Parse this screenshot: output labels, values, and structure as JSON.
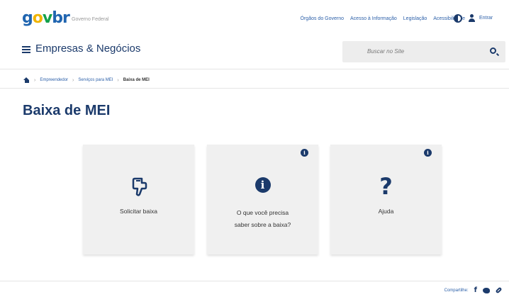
{
  "govbar": {
    "logo": {
      "g": "g",
      "o": "o",
      "v": "v",
      "br": "br"
    },
    "subtitle": "Governo Federal",
    "links": [
      "Órgãos do Governo",
      "Acesso à Informação",
      "Legislação",
      "Acessibilidade"
    ],
    "login_label": "Entrar"
  },
  "header": {
    "site_title": "Empresas & Negócios",
    "search_placeholder": "Buscar no Site"
  },
  "breadcrumb": {
    "items": [
      "Empreendedor",
      "Serviços para MEI"
    ],
    "current": "Baixa de MEI"
  },
  "page": {
    "title": "Baixa de MEI"
  },
  "cards": [
    {
      "label": "Solicitar baixa",
      "icon": "pointing-hand-icon"
    },
    {
      "label_line1": "O que você precisa",
      "label_line2": "saber sobre a baixa?",
      "icon": "info-circle-icon"
    },
    {
      "label": "Ajuda",
      "icon": "question-mark-icon"
    }
  ],
  "share": {
    "label": "Compartilhe:"
  },
  "colors": {
    "primary": "#1b3a6b",
    "link": "#2b5fa8",
    "card_bg": "#f0f0f0"
  }
}
